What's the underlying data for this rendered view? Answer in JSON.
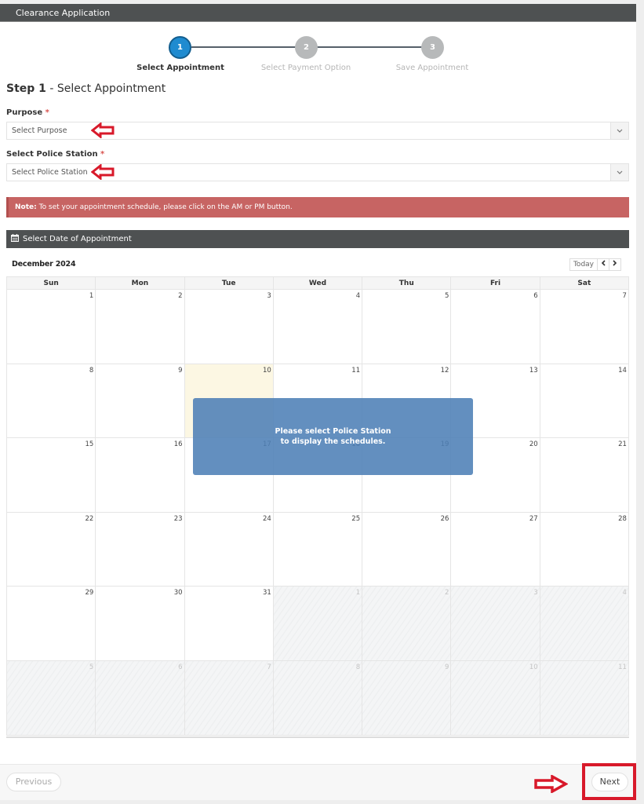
{
  "window": {
    "title": "Clearance Application"
  },
  "stepper": {
    "steps": [
      {
        "number": "1",
        "label": "Select Appointment",
        "state": "active"
      },
      {
        "number": "2",
        "label": "Select Payment Option",
        "state": "inactive"
      },
      {
        "number": "3",
        "label": "Save Appointment",
        "state": "inactive"
      }
    ]
  },
  "step_title": {
    "prefix": "Step 1",
    "separator": " - ",
    "text": "Select Appointment"
  },
  "form": {
    "purpose": {
      "label": "Purpose",
      "required_mark": "*",
      "value": "Select Purpose",
      "caret_icon": "chevron-down-icon"
    },
    "station": {
      "label": "Select Police Station",
      "required_mark": "*",
      "value": "Select Police Station",
      "caret_icon": "chevron-down-icon"
    }
  },
  "note": {
    "label": "Note:",
    "text": " To set your appointment schedule, please click on the AM or PM button."
  },
  "calendar": {
    "header": "Select Date of Appointment",
    "header_icon": "calendar-icon",
    "month": "December 2024",
    "today_label": "Today",
    "prev_icon": "‹",
    "next_icon": "›",
    "days_of_week": [
      "Sun",
      "Mon",
      "Tue",
      "Wed",
      "Thu",
      "Fri",
      "Sat"
    ],
    "weeks": [
      [
        {
          "d": "1"
        },
        {
          "d": "2"
        },
        {
          "d": "3"
        },
        {
          "d": "4"
        },
        {
          "d": "5"
        },
        {
          "d": "6"
        },
        {
          "d": "7"
        }
      ],
      [
        {
          "d": "8"
        },
        {
          "d": "9"
        },
        {
          "d": "10",
          "today": true
        },
        {
          "d": "11"
        },
        {
          "d": "12"
        },
        {
          "d": "13"
        },
        {
          "d": "14"
        }
      ],
      [
        {
          "d": "15"
        },
        {
          "d": "16"
        },
        {
          "d": "17"
        },
        {
          "d": "18"
        },
        {
          "d": "19"
        },
        {
          "d": "20"
        },
        {
          "d": "21"
        }
      ],
      [
        {
          "d": "22"
        },
        {
          "d": "23"
        },
        {
          "d": "24"
        },
        {
          "d": "25"
        },
        {
          "d": "26"
        },
        {
          "d": "27"
        },
        {
          "d": "28"
        }
      ],
      [
        {
          "d": "29"
        },
        {
          "d": "30"
        },
        {
          "d": "31"
        },
        {
          "d": "1",
          "other": true
        },
        {
          "d": "2",
          "other": true
        },
        {
          "d": "3",
          "other": true
        },
        {
          "d": "4",
          "other": true
        }
      ],
      [
        {
          "d": "5",
          "other": true
        },
        {
          "d": "6",
          "other": true
        },
        {
          "d": "7",
          "other": true
        },
        {
          "d": "8",
          "other": true
        },
        {
          "d": "9",
          "other": true
        },
        {
          "d": "10",
          "other": true
        },
        {
          "d": "11",
          "other": true
        }
      ]
    ],
    "overlay_message": {
      "line1": "Please select Police Station",
      "line2": "to display the schedules."
    }
  },
  "footer": {
    "previous_label": "Previous",
    "next_label": "Next"
  },
  "annotations": {
    "color": "#d8192a"
  },
  "colors": {
    "accent": "#1f8bd0",
    "note_bg": "#c76463",
    "header_bg": "#4e5152",
    "overlay_bg": "#4d80b6"
  }
}
